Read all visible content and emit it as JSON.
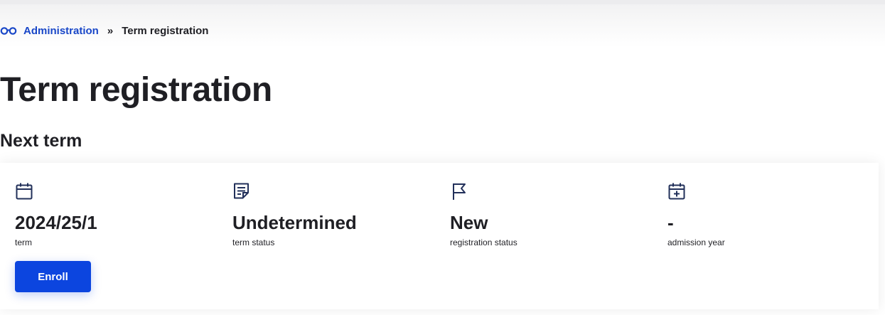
{
  "breadcrumb": {
    "icon": "glasses-icon",
    "root": "Administration",
    "separator": "»",
    "current": "Term registration"
  },
  "page": {
    "title": "Term registration",
    "section_title": "Next term"
  },
  "colors": {
    "accent": "#0c45df",
    "link": "#1947c8",
    "text": "#1f1f24",
    "icon": "#22305a"
  },
  "summary": {
    "items": [
      {
        "icon": "calendar-icon",
        "value": "2024/25/1",
        "label": "term"
      },
      {
        "icon": "document-edit-icon",
        "value": "Undetermined",
        "label": "term status"
      },
      {
        "icon": "flag-icon",
        "value": "New",
        "label": "registration status"
      },
      {
        "icon": "calendar-plus-icon",
        "value": "-",
        "label": "admission year"
      }
    ],
    "enroll_label": "Enroll"
  }
}
